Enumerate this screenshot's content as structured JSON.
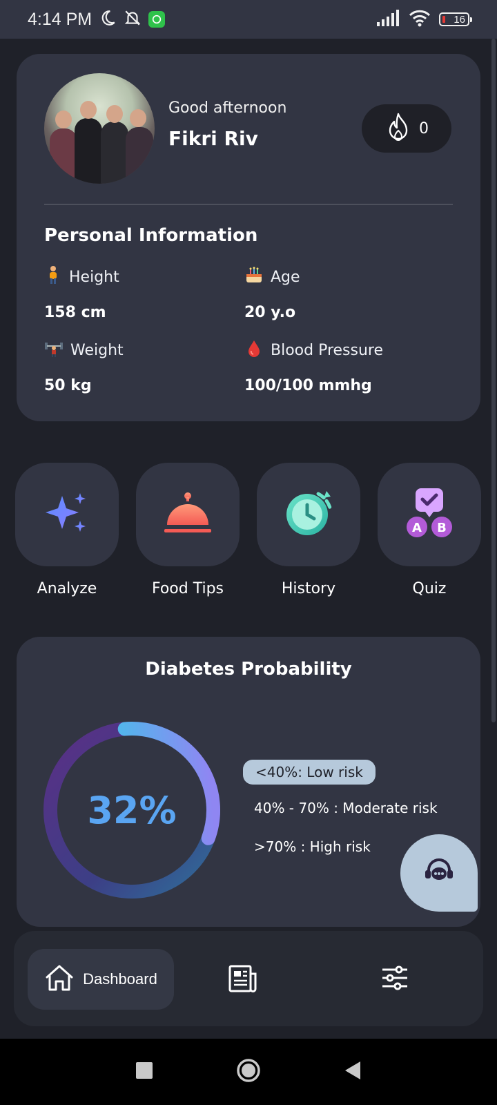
{
  "status_bar": {
    "time": "4:14 PM",
    "battery": "16"
  },
  "profile": {
    "greeting": "Good afternoon",
    "name": "Fikri Riv",
    "streak": "0"
  },
  "personal_info": {
    "title": "Personal Information",
    "height": {
      "label": "Height",
      "value": "158 cm",
      "icon": "person-icon"
    },
    "age": {
      "label": "Age",
      "value": "20 y.o",
      "icon": "cake-icon"
    },
    "weight": {
      "label": "Weight",
      "value": "50 kg",
      "icon": "weightlifter-icon"
    },
    "blood_pressure": {
      "label": "Blood Pressure",
      "value": "100/100 mmhg",
      "icon": "blood-drop-icon"
    }
  },
  "actions": [
    {
      "label": "Analyze",
      "icon": "sparkle-icon"
    },
    {
      "label": "Food Tips",
      "icon": "cloche-icon"
    },
    {
      "label": "History",
      "icon": "clock-history-icon"
    },
    {
      "label": "Quiz",
      "icon": "quiz-icon"
    }
  ],
  "probability": {
    "title": "Diabetes Probability",
    "percent_text": "32%",
    "percent": 32,
    "legend_low": "<40%: Low risk",
    "legend_moderate": "40% - 70% : Moderate risk",
    "legend_high": ">70% : High risk"
  },
  "bottom_nav": {
    "dashboard_label": "Dashboard"
  },
  "colors": {
    "background": "#1f2129",
    "card": "#323543",
    "accent_blue": "#5aa5f2",
    "legend_badge": "#b6c9db"
  }
}
